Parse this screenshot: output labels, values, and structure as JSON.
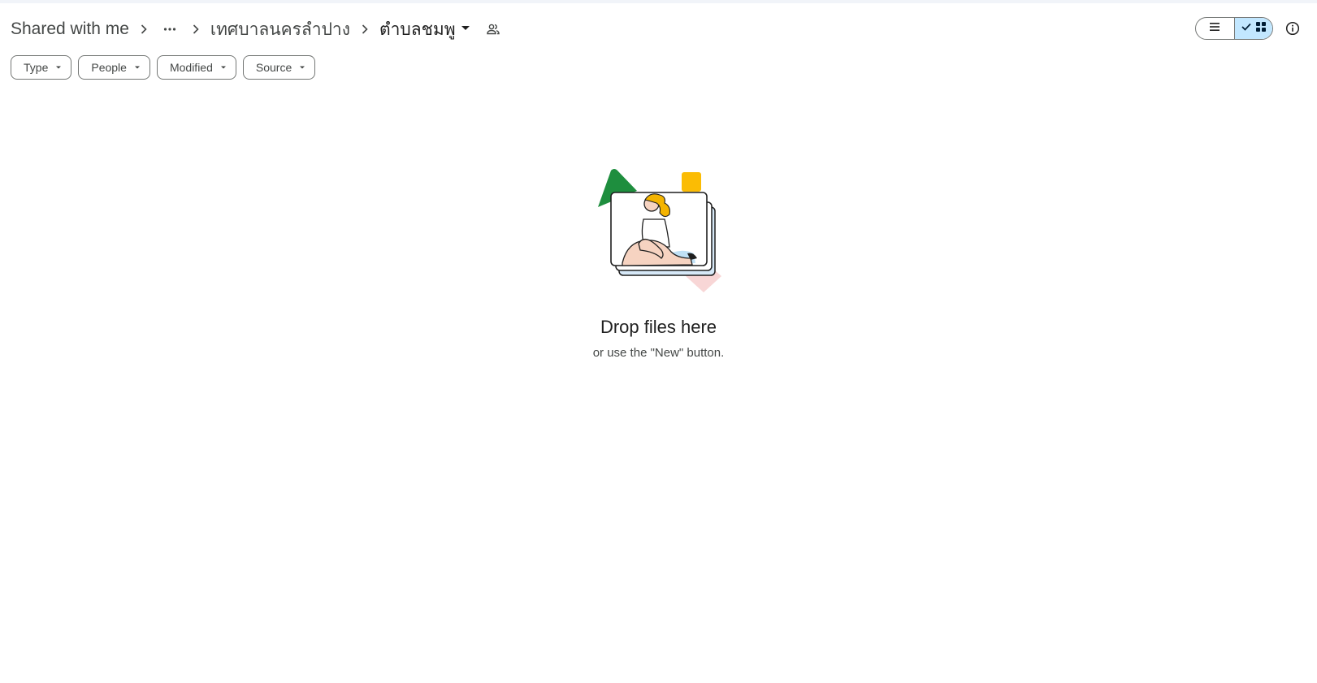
{
  "breadcrumb": {
    "root": "Shared with me",
    "more_icon": "more-horiz-icon",
    "parent": "เทศบาลนครลำปาง",
    "current": "ตำบลชมพู",
    "shared_icon": "people-icon"
  },
  "view": {
    "list_icon": "list-view-icon",
    "grid_icon": "grid-view-icon",
    "selected": "grid",
    "info_icon": "info-icon"
  },
  "filters": [
    {
      "label": "Type"
    },
    {
      "label": "People"
    },
    {
      "label": "Modified"
    },
    {
      "label": "Source"
    }
  ],
  "empty_state": {
    "title": "Drop files here",
    "subtitle": "or use the \"New\" button."
  },
  "colors": {
    "accent_selected": "#c2e7ff",
    "green": "#1e8e3e",
    "yellow": "#fbbc04",
    "pink": "#f6d3d3"
  }
}
